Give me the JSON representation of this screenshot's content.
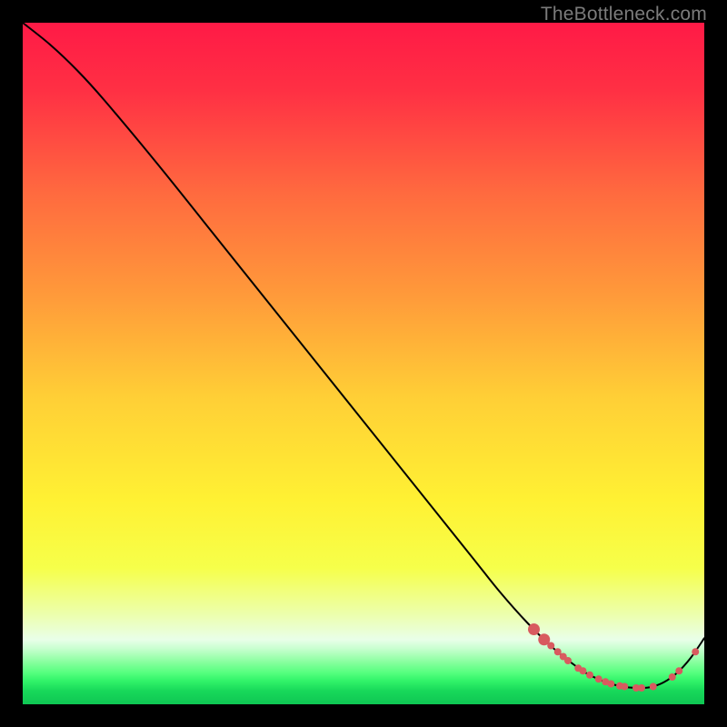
{
  "watermark": "TheBottleneck.com",
  "gradient": {
    "stops": [
      {
        "offset": 0.0,
        "color": "#ff1a46"
      },
      {
        "offset": 0.1,
        "color": "#ff3044"
      },
      {
        "offset": 0.25,
        "color": "#ff6a3f"
      },
      {
        "offset": 0.4,
        "color": "#ff9a3a"
      },
      {
        "offset": 0.55,
        "color": "#ffcf36"
      },
      {
        "offset": 0.7,
        "color": "#fff133"
      },
      {
        "offset": 0.8,
        "color": "#f6ff4a"
      },
      {
        "offset": 0.87,
        "color": "#ecffb0"
      },
      {
        "offset": 0.905,
        "color": "#e9ffe9"
      },
      {
        "offset": 0.918,
        "color": "#c9ffd0"
      },
      {
        "offset": 0.93,
        "color": "#a3ffb2"
      },
      {
        "offset": 0.942,
        "color": "#7bff96"
      },
      {
        "offset": 0.954,
        "color": "#55ff7e"
      },
      {
        "offset": 0.965,
        "color": "#33f46a"
      },
      {
        "offset": 0.98,
        "color": "#18d95a"
      },
      {
        "offset": 1.0,
        "color": "#0fc653"
      }
    ]
  },
  "curve_style": {
    "stroke": "#000000",
    "width": 2
  },
  "marker_style": {
    "fill": "#d85a5f",
    "radius_small": 4.0,
    "radius_large": 6.5
  },
  "chart_data": {
    "type": "line",
    "title": "",
    "xlabel": "",
    "ylabel": "",
    "xlim": [
      0,
      100
    ],
    "ylim": [
      0,
      100
    ],
    "series": [
      {
        "name": "curve",
        "x": [
          0.0,
          4.0,
          8.0,
          12.0,
          20.0,
          30.0,
          40.0,
          50.0,
          60.0,
          66.0,
          70.0,
          74.0,
          78.0,
          82.0,
          84.0,
          86.0,
          88.0,
          90.0,
          92.0,
          94.0,
          96.0,
          98.0,
          100.0
        ],
        "y": [
          100.0,
          96.8,
          93.0,
          88.6,
          79.0,
          66.5,
          54.0,
          41.5,
          29.0,
          21.5,
          16.5,
          12.0,
          8.1,
          5.0,
          3.9,
          3.1,
          2.6,
          2.4,
          2.5,
          3.2,
          4.6,
          6.8,
          9.7
        ]
      }
    ],
    "markers": [
      {
        "x": 75.0,
        "y": 11.0,
        "r": "large"
      },
      {
        "x": 76.5,
        "y": 9.5,
        "r": "large"
      },
      {
        "x": 77.5,
        "y": 8.6,
        "r": "small"
      },
      {
        "x": 78.5,
        "y": 7.7,
        "r": "small"
      },
      {
        "x": 79.3,
        "y": 7.0,
        "r": "small"
      },
      {
        "x": 80.0,
        "y": 6.4,
        "r": "small"
      },
      {
        "x": 81.5,
        "y": 5.3,
        "r": "small"
      },
      {
        "x": 82.2,
        "y": 4.9,
        "r": "small"
      },
      {
        "x": 83.2,
        "y": 4.3,
        "r": "small"
      },
      {
        "x": 84.5,
        "y": 3.7,
        "r": "small"
      },
      {
        "x": 85.5,
        "y": 3.3,
        "r": "small"
      },
      {
        "x": 86.3,
        "y": 3.0,
        "r": "small"
      },
      {
        "x": 87.6,
        "y": 2.7,
        "r": "small"
      },
      {
        "x": 88.3,
        "y": 2.6,
        "r": "small"
      },
      {
        "x": 90.0,
        "y": 2.4,
        "r": "small"
      },
      {
        "x": 90.8,
        "y": 2.4,
        "r": "small"
      },
      {
        "x": 92.5,
        "y": 2.6,
        "r": "small"
      },
      {
        "x": 95.3,
        "y": 4.0,
        "r": "small"
      },
      {
        "x": 96.3,
        "y": 4.9,
        "r": "small"
      },
      {
        "x": 98.7,
        "y": 7.7,
        "r": "small"
      }
    ]
  }
}
